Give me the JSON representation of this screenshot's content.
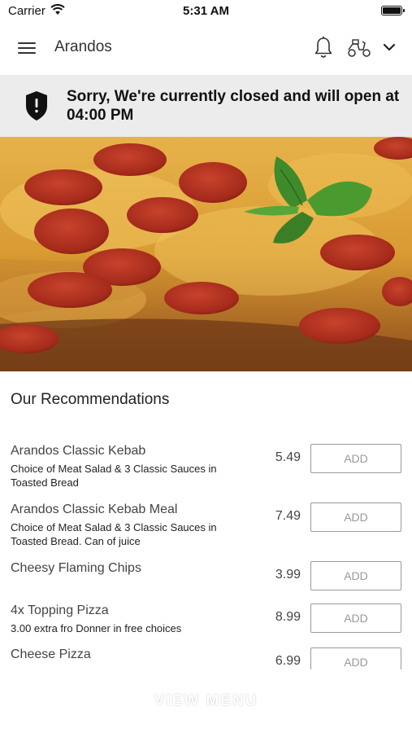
{
  "status_bar": {
    "carrier": "Carrier",
    "time": "5:31 AM"
  },
  "header": {
    "title": "Arandos",
    "icons": [
      "menu-icon",
      "bell-icon",
      "scooter-icon",
      "chevron-down-icon"
    ]
  },
  "banner": {
    "message": "Sorry, We're currently closed and will open at 04:00 PM",
    "icon": "shield-alert-icon"
  },
  "hero": {
    "image": "pepperoni-pizza-with-basil"
  },
  "recommendations": {
    "title": "Our Recommendations",
    "items": [
      {
        "name": "Arandos Classic Kebab",
        "description": "Choice of Meat Salad & 3 Classic Sauces in Toasted Bread",
        "price": "5.49",
        "button": "ADD"
      },
      {
        "name": "Arandos Classic Kebab Meal",
        "description": "Choice of Meat Salad & 3 Classic Sauces in Toasted Bread. Can of juice",
        "price": "7.49",
        "button": "ADD"
      },
      {
        "name": "Cheesy Flaming Chips",
        "description": "",
        "price": "3.99",
        "button": "ADD"
      },
      {
        "name": "4x Topping Pizza",
        "description": "3.00 extra fro Donner in free choices",
        "price": "8.99",
        "button": "ADD"
      },
      {
        "name": "Cheese Pizza",
        "description": "",
        "price": "6.99",
        "button": "ADD"
      }
    ]
  },
  "footer": {
    "view_menu": "VIEW MENU"
  },
  "colors": {
    "banner_bg": "#ececec",
    "button_border": "#9a9a9a",
    "text": "#222222"
  }
}
